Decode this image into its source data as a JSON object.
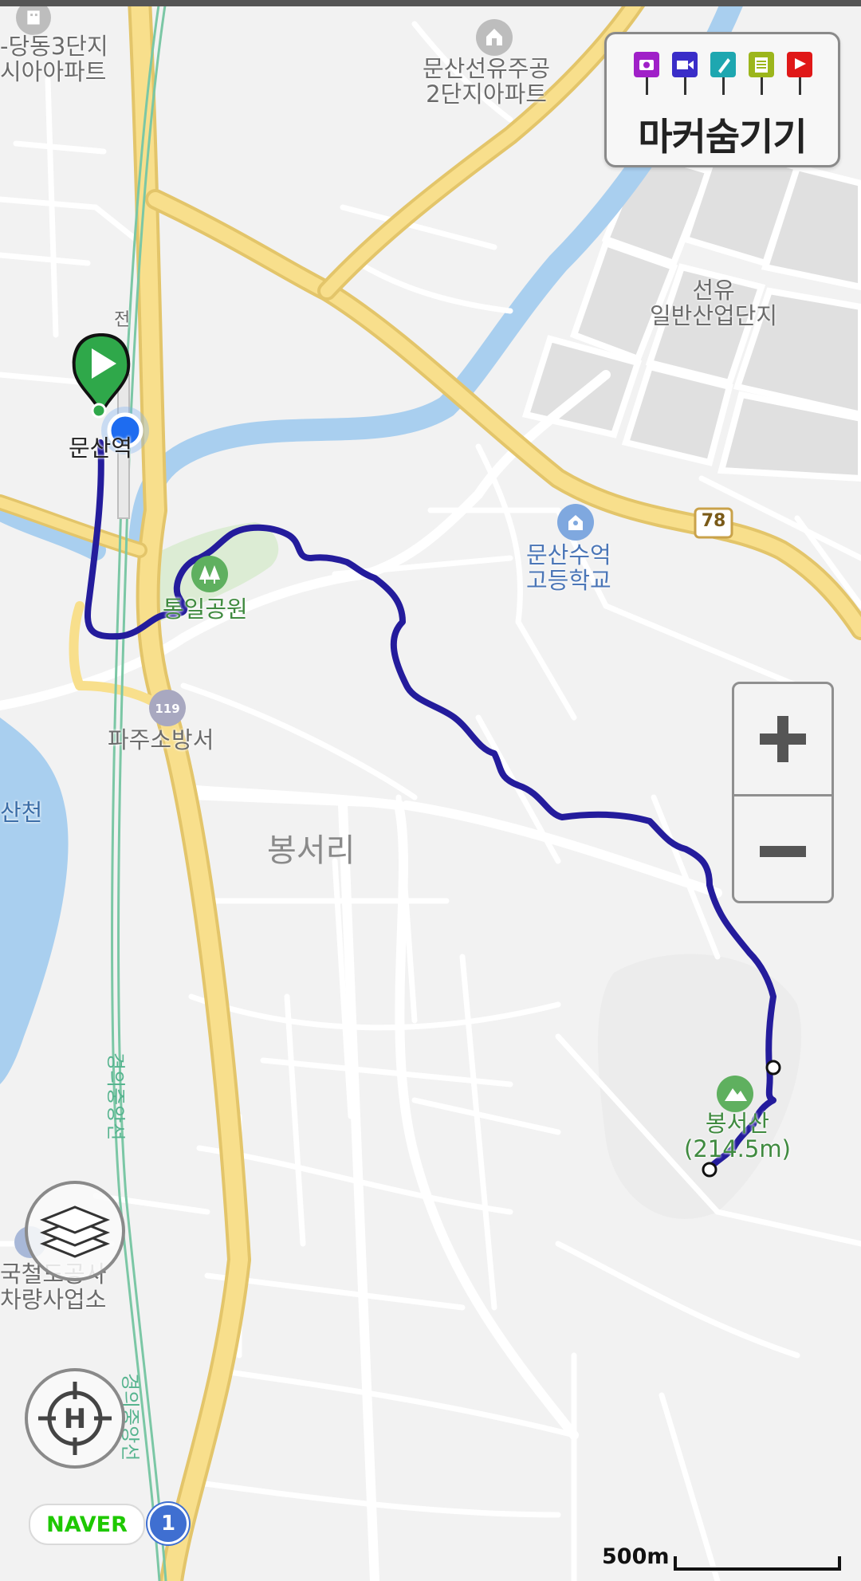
{
  "marker_toggle": {
    "label": "마커숨기기",
    "icons": [
      "camera-marker-icon",
      "video-marker-icon",
      "pin-marker-icon",
      "memo-marker-icon",
      "flag-marker-icon"
    ],
    "colors": [
      "#a020c8",
      "#3a2dc8",
      "#1ea7b0",
      "#9cb61c",
      "#e01818"
    ]
  },
  "zoom": {
    "in_icon": "plus-icon",
    "out_icon": "minus-icon"
  },
  "controls": {
    "layers_icon": "layers-icon",
    "location_icon": "crosshair-h-icon"
  },
  "branding": {
    "logo": "NAVER",
    "route_badge": "1"
  },
  "scale": {
    "label": "500m"
  },
  "labels": {
    "apt1": "-당동3단지\n시아아파트",
    "apt2": "문산선유주공\n2단지아파트",
    "industrial": "선유\n일반산업단지",
    "station": "문산역",
    "station_hint": "전",
    "school": "문산수억\n고등학교",
    "park": "통일공원",
    "fire_station": "파주소방서",
    "district": "봉서리",
    "stream": "산천",
    "mountain": "봉서산\n(214.5m)",
    "rail1": "경의중앙선",
    "rail2": "경의중앙선",
    "korail": "국철도공사\n차량사업소",
    "road_78": "78"
  },
  "colors": {
    "track": "#241c9c",
    "road_major": "#f8df8c",
    "water": "#a9cfef",
    "start_marker": "#2fa84a",
    "current_location": "#1e6cf0"
  }
}
